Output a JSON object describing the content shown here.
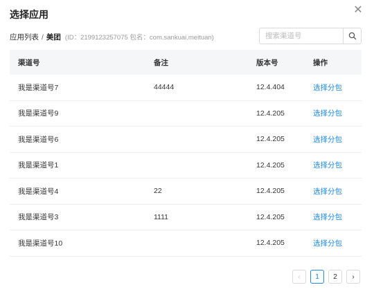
{
  "dialog": {
    "title": "选择应用",
    "close_icon": "close-icon"
  },
  "breadcrumb": {
    "root": "应用列表",
    "separator": "/",
    "current": "美团",
    "meta": "(ID：2199123257075 包名：com.sankuai.meituan)"
  },
  "search": {
    "placeholder": "搜索渠道号",
    "icon": "search-icon"
  },
  "table": {
    "headers": [
      "渠道号",
      "备注",
      "版本号",
      "操作"
    ],
    "rows": [
      {
        "channel": "我是渠道号7",
        "note": "44444",
        "version": "12.4.404",
        "action": "选择分包"
      },
      {
        "channel": "我是渠道号9",
        "note": "",
        "version": "12.4.205",
        "action": "选择分包"
      },
      {
        "channel": "我是渠道号6",
        "note": "",
        "version": "12.4.205",
        "action": "选择分包"
      },
      {
        "channel": "我是渠道号1",
        "note": "",
        "version": "12.4.205",
        "action": "选择分包"
      },
      {
        "channel": "我是渠道号4",
        "note": "22",
        "version": "12.4.205",
        "action": "选择分包"
      },
      {
        "channel": "我是渠道号3",
        "note": "1111",
        "version": "12.4.205",
        "action": "选择分包"
      },
      {
        "channel": "我是渠道号10",
        "note": "",
        "version": "12.4.205",
        "action": "选择分包"
      }
    ]
  },
  "pagination": {
    "prev": "‹",
    "pages": [
      "1",
      "2"
    ],
    "current": "1",
    "next": "›"
  },
  "colors": {
    "link": "#1e88e5",
    "header_bg": "#f5f6f8"
  }
}
